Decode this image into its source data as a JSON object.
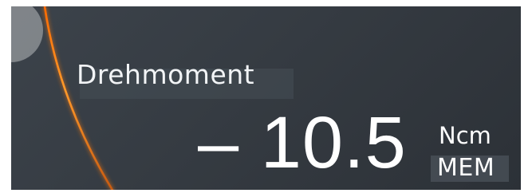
{
  "display": {
    "label": "Drehmoment",
    "value": "– 10.5",
    "unit": "Ncm",
    "memory_badge": "MEM"
  },
  "colors": {
    "background": "#363c43",
    "accent_arc": "#ff8a1a",
    "text": "#ffffff"
  },
  "icons": {
    "decorative_arc": "orange-arc-icon"
  }
}
